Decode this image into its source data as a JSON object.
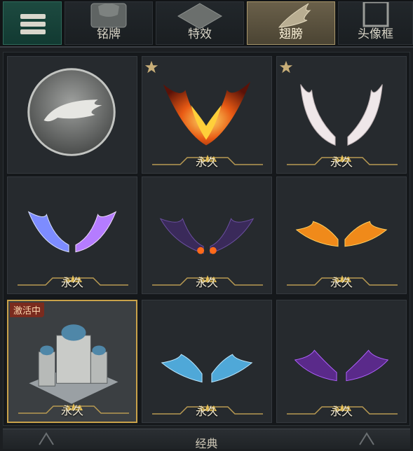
{
  "tabs": [
    {
      "label": "铭牌",
      "active": false
    },
    {
      "label": "特效",
      "active": false
    },
    {
      "label": "翅膀",
      "active": true
    },
    {
      "label": "头像框",
      "active": false
    }
  ],
  "items": [
    {
      "name": "default-wing-medallion",
      "duration": "",
      "favorite": false,
      "badge": ""
    },
    {
      "name": "phoenix-fire-wings",
      "duration": "永久",
      "favorite": true,
      "badge": ""
    },
    {
      "name": "white-angel-wings",
      "duration": "永久",
      "favorite": true,
      "badge": ""
    },
    {
      "name": "blue-crystal-wings",
      "duration": "永久",
      "favorite": false,
      "badge": ""
    },
    {
      "name": "dark-shadow-wings",
      "duration": "永久",
      "favorite": false,
      "badge": ""
    },
    {
      "name": "flame-wings",
      "duration": "永久",
      "favorite": false,
      "badge": ""
    },
    {
      "name": "castle-ornament",
      "duration": "永久",
      "favorite": false,
      "badge": "激活中"
    },
    {
      "name": "ice-blue-wings",
      "duration": "永久",
      "favorite": false,
      "badge": ""
    },
    {
      "name": "purple-demon-wings",
      "duration": "永久",
      "favorite": false,
      "badge": ""
    }
  ],
  "footer": {
    "label": "经典"
  },
  "colors": {
    "accent_gold": "#c9a24a",
    "active_tab": "#6a604a",
    "menu_green": "#1d4a40"
  }
}
